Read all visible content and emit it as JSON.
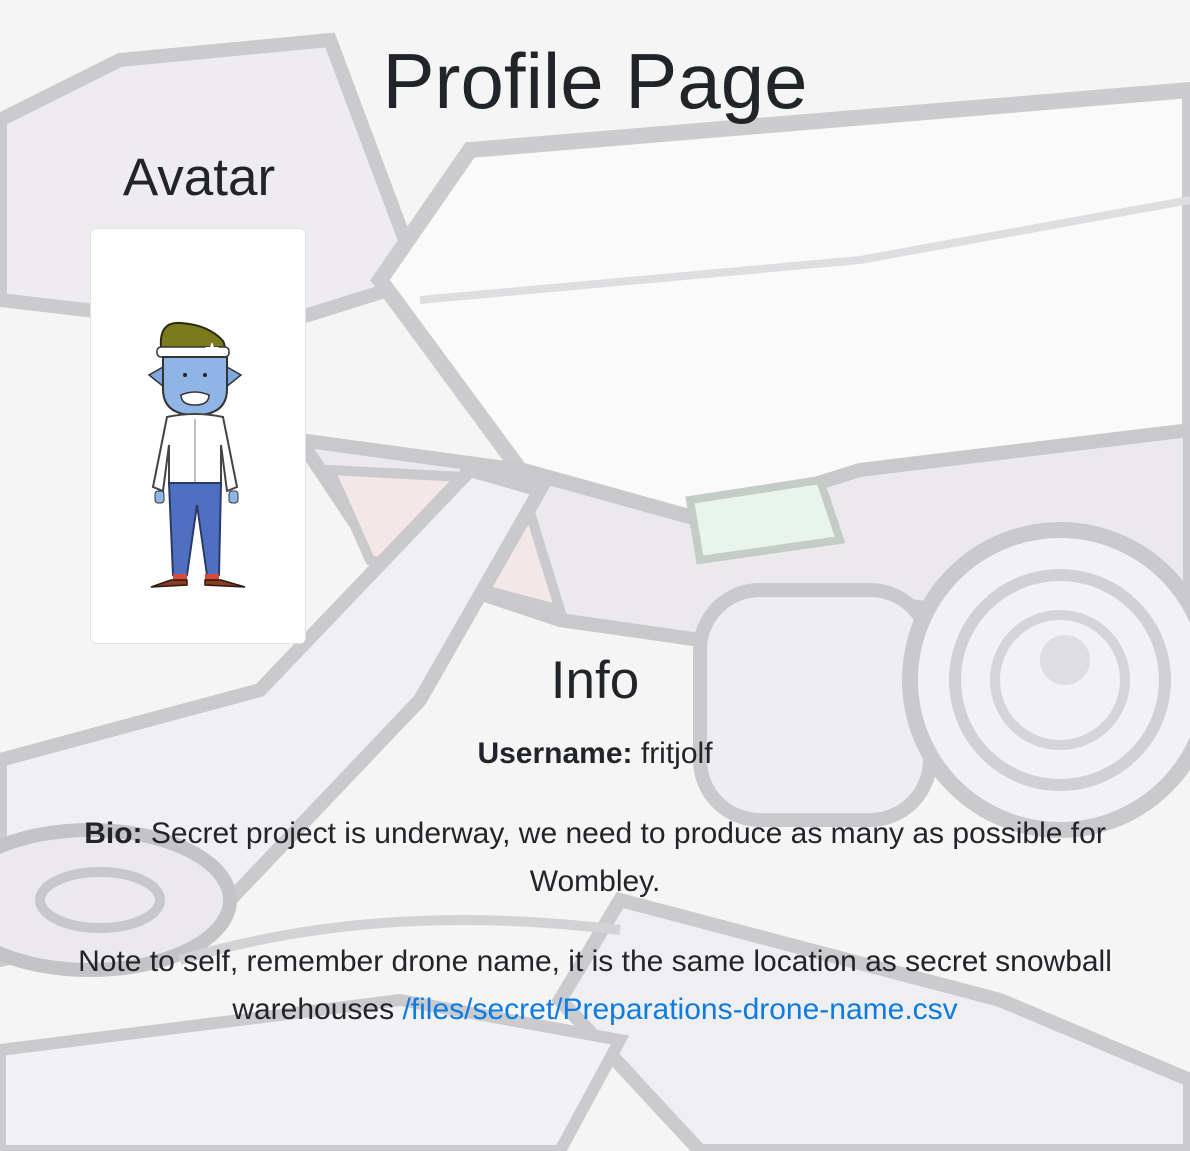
{
  "page": {
    "title": "Profile Page"
  },
  "avatar": {
    "heading": "Avatar",
    "image_icon": "elf-avatar-icon"
  },
  "info": {
    "heading": "Info",
    "username_label": "Username:",
    "username_value": "fritjolf",
    "bio_label": "Bio:",
    "bio_text": "Secret project is underway, we need to produce as many as possible for Wombley.",
    "note_text": "Note to self, remember drone name, it is the same location as secret snowball warehouses",
    "note_link_text": "/files/secret/Preparations-drone-name.csv"
  },
  "colors": {
    "link": "#0d7ce0",
    "text": "#212529",
    "background": "#ecebee"
  },
  "background": {
    "illustration_icon": "drone-illustration-icon"
  }
}
